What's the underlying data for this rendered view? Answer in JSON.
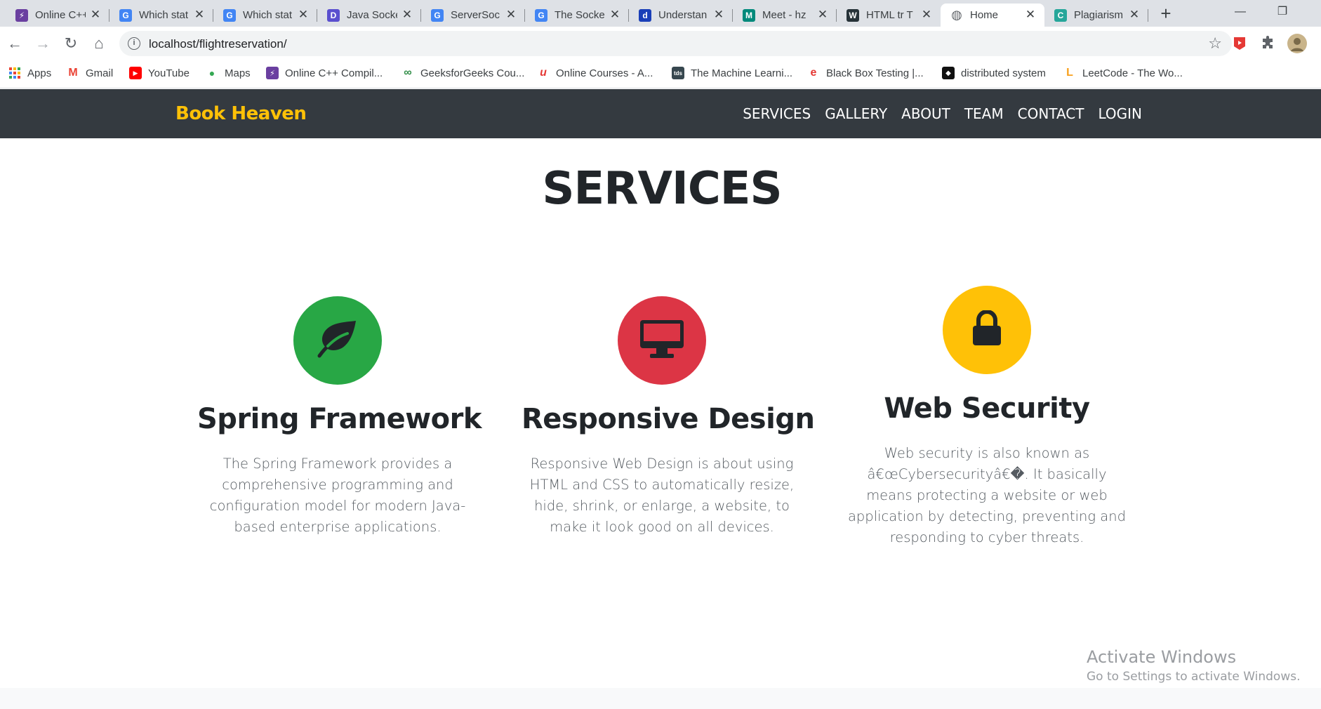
{
  "browser": {
    "tabs": [
      {
        "title": "Online C++",
        "favicon_color": "#6a3fa0",
        "favicon_glyph": "⚡"
      },
      {
        "title": "Which stat",
        "favicon_color": "#4285f4",
        "favicon_glyph": "G"
      },
      {
        "title": "Which stat",
        "favicon_color": "#4285f4",
        "favicon_glyph": "G"
      },
      {
        "title": "Java Socke",
        "favicon_color": "#5a4fcf",
        "favicon_glyph": "D"
      },
      {
        "title": "ServerSoc",
        "favicon_color": "#4285f4",
        "favicon_glyph": "G"
      },
      {
        "title": "The Socke",
        "favicon_color": "#4285f4",
        "favicon_glyph": "G"
      },
      {
        "title": "Understan",
        "favicon_color": "#1a3fb8",
        "favicon_glyph": "d"
      },
      {
        "title": "Meet - hz",
        "favicon_color": "#00897b",
        "favicon_glyph": "M"
      },
      {
        "title": "HTML tr T",
        "favicon_color": "#263238",
        "favicon_glyph": "W"
      },
      {
        "title": "Home",
        "favicon_color": "#5f6368",
        "favicon_glyph": "◍",
        "active": true
      },
      {
        "title": "Plagiarism",
        "favicon_color": "#26a69a",
        "favicon_glyph": "C"
      }
    ],
    "url": "localhost/flightreservation/",
    "bookmarks": [
      {
        "label": "Apps",
        "color": "#ea4335",
        "glyph": "⋮⋮"
      },
      {
        "label": "Gmail",
        "color": "#ea4335",
        "glyph": "M"
      },
      {
        "label": "YouTube",
        "color": "#ff0000",
        "glyph": "▶"
      },
      {
        "label": "Maps",
        "color": "#34a853",
        "glyph": "●"
      },
      {
        "label": "Online C++ Compil...",
        "color": "#6a3fa0",
        "glyph": "⚡"
      },
      {
        "label": "GeeksforGeeks Cou...",
        "color": "#2f8d46",
        "glyph": "∞"
      },
      {
        "label": "Online Courses - A...",
        "color": "#e53935",
        "glyph": "u"
      },
      {
        "label": "The Machine Learni...",
        "color": "#37474f",
        "glyph": "tds"
      },
      {
        "label": "Black Box Testing |...",
        "color": "#e53935",
        "glyph": "e"
      },
      {
        "label": "distributed system",
        "color": "#111111",
        "glyph": "◆"
      },
      {
        "label": "LeetCode - The Wo...",
        "color": "#f89f1b",
        "glyph": "L"
      }
    ]
  },
  "site": {
    "brand": "Book Heaven",
    "nav": [
      "SERVICES",
      "GALLERY",
      "ABOUT",
      "TEAM",
      "CONTACT",
      "LOGIN"
    ],
    "section_title": "SERVICES",
    "services": [
      {
        "icon": "leaf-icon",
        "color": "#28a745",
        "title": "Spring Framework",
        "text": "The Spring Framework provides a comprehensive programming and configuration model for modern Java-based enterprise applications."
      },
      {
        "icon": "desktop-icon",
        "color": "#dc3545",
        "title": "Responsive Design",
        "text": "Responsive Web Design is about using HTML and CSS to automatically resize, hide, shrink, or enlarge, a website, to make it look good on all devices."
      },
      {
        "icon": "lock-icon",
        "color": "#ffc107",
        "title": "Web Security",
        "text": "Web security is also known as â€œCybersecurityâ€�. It basically means protecting a website or web application by detecting, preventing and responding to cyber threats."
      }
    ]
  },
  "watermark": {
    "line1": "Activate Windows",
    "line2": "Go to Settings to activate Windows."
  }
}
